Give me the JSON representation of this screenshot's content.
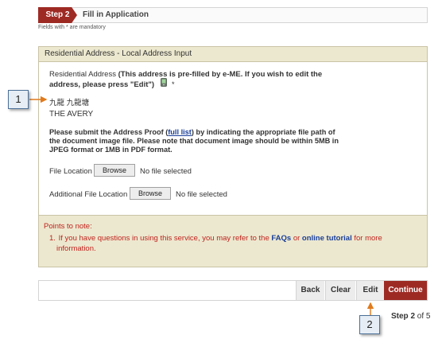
{
  "step": {
    "badge": "Step 2",
    "title": "Fill in Application",
    "mandatory_note": "Fields with * are mandatory"
  },
  "panel": {
    "header": "Residential Address - Local Address Input",
    "residential_label": "Residential Address",
    "prefill_note_part1": "(This address is pre-filled by e-ME. If you wish to edit the",
    "prefill_note_part2": "address, please press \"Edit\")",
    "asterisk": "*",
    "chinese_address": "九龍 九龍塘",
    "building_name": "THE AVERY",
    "proof_text_before": "Please submit the Address Proof (",
    "proof_link": "full list",
    "proof_text_after": ") by indicating the appropriate file path of the document image file. Please note that document image should be within 5MB in JPEG format or 1MB in PDF format.",
    "file_location_label": "File Location",
    "additional_file_label": "Additional File Location",
    "browse_label": "Browse",
    "no_file_text": "No file selected"
  },
  "notes": {
    "title": "Points to note:",
    "item1_number": "1.",
    "item1_before": "If you have questions in using this service, you may refer to the ",
    "faq_link": "FAQs",
    "item1_middle": " or ",
    "tutorial_link": "online tutorial",
    "item1_after": " for more",
    "item1_cont": "information."
  },
  "buttons": {
    "back": "Back",
    "clear": "Clear",
    "edit": "Edit",
    "continue": "Continue"
  },
  "progress": {
    "prefix": "Step ",
    "current": "2",
    "suffix": " of 5"
  },
  "callouts": {
    "one": "1",
    "two": "2"
  },
  "colors": {
    "brand": "#9e2a24",
    "panel_header": "#ece8cf",
    "notes_text": "#c0231e",
    "link": "#1a3f99",
    "callout_arrow": "#e07a1c"
  },
  "icons": {
    "device": "mobile-phone-icon"
  }
}
